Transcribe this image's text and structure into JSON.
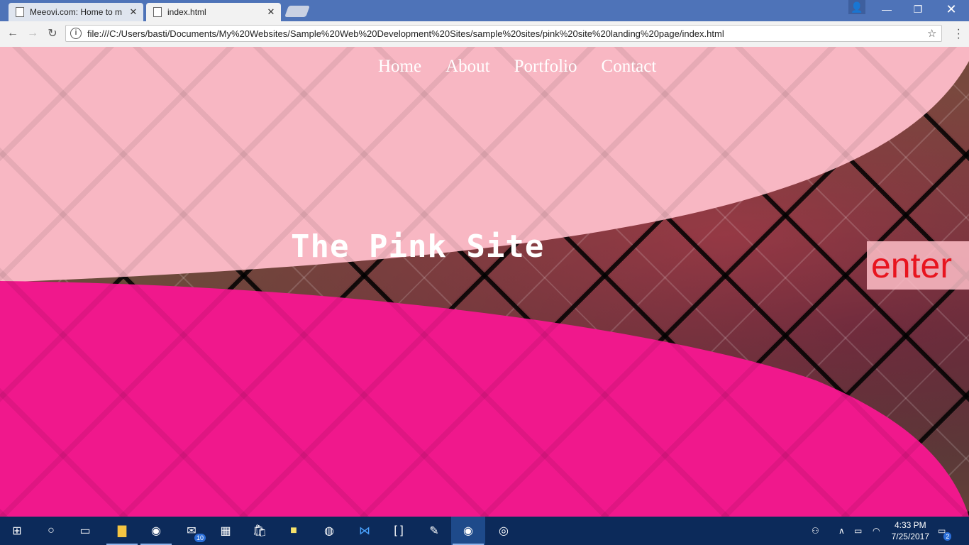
{
  "browser": {
    "tabs": [
      {
        "label": "Meeovi.com: Home to m",
        "active": false
      },
      {
        "label": "index.html",
        "active": true
      }
    ],
    "url": "file:///C:/Users/basti/Documents/My%20Websites/Sample%20Web%20Development%20Sites/sample%20sites/pink%20site%20landing%20page/index.html"
  },
  "page": {
    "nav": [
      "Home",
      "About",
      "Portfolio",
      "Contact"
    ],
    "title": "The Pink Site",
    "enter": "enter"
  },
  "taskbar": {
    "mail_badge": "10",
    "time": "4:33 PM",
    "date": "7/25/2017",
    "notifications": "2"
  },
  "colors": {
    "light_pink": "#f8b7c3",
    "hot_pink": "#f0188c",
    "browser_frame": "#4e73b8",
    "taskbar": "#0c2a5a",
    "enter_text": "#e8141e"
  }
}
